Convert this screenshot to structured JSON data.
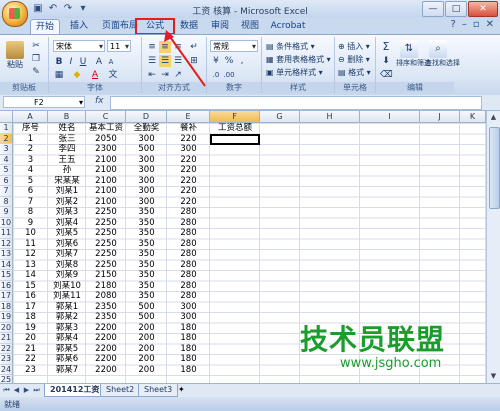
{
  "window": {
    "title": "工资 核算 - Microsoft Excel",
    "minimize": "—",
    "maximize": "□",
    "close": "✕"
  },
  "tabs": [
    "开始",
    "插入",
    "页面布局",
    "公式",
    "数据",
    "审阅",
    "视图",
    "Acrobat"
  ],
  "ribbon": {
    "clipboard": {
      "label": "剪贴板",
      "paste": "粘贴"
    },
    "font": {
      "label": "字体",
      "name": "宋体",
      "size": "11"
    },
    "alignment": {
      "label": "对齐方式"
    },
    "number": {
      "label": "数字",
      "format": "常规"
    },
    "styles": {
      "label": "样式",
      "conditional": "条件格式",
      "table": "套用表格格式",
      "cell": "单元格样式"
    },
    "cells": {
      "label": "单元格",
      "insert": "插入",
      "delete": "删除",
      "format": "格式"
    },
    "editing": {
      "label": "编辑",
      "sort": "排序和筛选",
      "find": "查找和选择"
    }
  },
  "formula_bar": {
    "name_box": "F2",
    "fx": "fx",
    "value": ""
  },
  "columns": [
    "A",
    "B",
    "C",
    "D",
    "E",
    "F",
    "G",
    "H",
    "I",
    "J",
    "K"
  ],
  "header_row": [
    "序号",
    "姓名",
    "基本工资",
    "全勤奖",
    "餐补",
    "工资总额"
  ],
  "rows": [
    [
      "1",
      "张三",
      "2050",
      "300",
      "220"
    ],
    [
      "2",
      "李四",
      "2300",
      "500",
      "300"
    ],
    [
      "3",
      "王五",
      "2100",
      "300",
      "220"
    ],
    [
      "4",
      "孙",
      "2100",
      "300",
      "220"
    ],
    [
      "5",
      "宋某某",
      "2100",
      "300",
      "220"
    ],
    [
      "6",
      "刘某1",
      "2100",
      "300",
      "220"
    ],
    [
      "7",
      "刘某2",
      "2100",
      "300",
      "220"
    ],
    [
      "8",
      "刘某3",
      "2250",
      "350",
      "280"
    ],
    [
      "9",
      "刘某4",
      "2250",
      "350",
      "280"
    ],
    [
      "10",
      "刘某5",
      "2250",
      "350",
      "280"
    ],
    [
      "11",
      "刘某6",
      "2250",
      "350",
      "280"
    ],
    [
      "12",
      "刘某7",
      "2250",
      "350",
      "280"
    ],
    [
      "13",
      "刘某8",
      "2250",
      "350",
      "280"
    ],
    [
      "14",
      "刘某9",
      "2150",
      "350",
      "280"
    ],
    [
      "15",
      "刘某10",
      "2180",
      "350",
      "280"
    ],
    [
      "16",
      "刘某11",
      "2080",
      "350",
      "280"
    ],
    [
      "17",
      "郭某1",
      "2350",
      "500",
      "300"
    ],
    [
      "18",
      "郭某2",
      "2350",
      "500",
      "300"
    ],
    [
      "19",
      "郭某3",
      "2200",
      "200",
      "180"
    ],
    [
      "20",
      "郭某4",
      "2200",
      "200",
      "180"
    ],
    [
      "21",
      "郭某5",
      "2200",
      "200",
      "180"
    ],
    [
      "22",
      "郭某6",
      "2200",
      "200",
      "180"
    ],
    [
      "23",
      "郭某7",
      "2200",
      "200",
      "180"
    ]
  ],
  "row_numbers": [
    "1",
    "2",
    "3",
    "4",
    "5",
    "6",
    "7",
    "8",
    "9",
    "10",
    "11",
    "12",
    "13",
    "14",
    "15",
    "16",
    "17",
    "18",
    "19",
    "20",
    "21",
    "22",
    "23",
    "24",
    "25"
  ],
  "sheet_tabs": [
    "201412工资",
    "Sheet2",
    "Sheet3"
  ],
  "status": "就绪",
  "watermark": {
    "main": "技术员联盟",
    "url": "www.jsgho.com"
  }
}
